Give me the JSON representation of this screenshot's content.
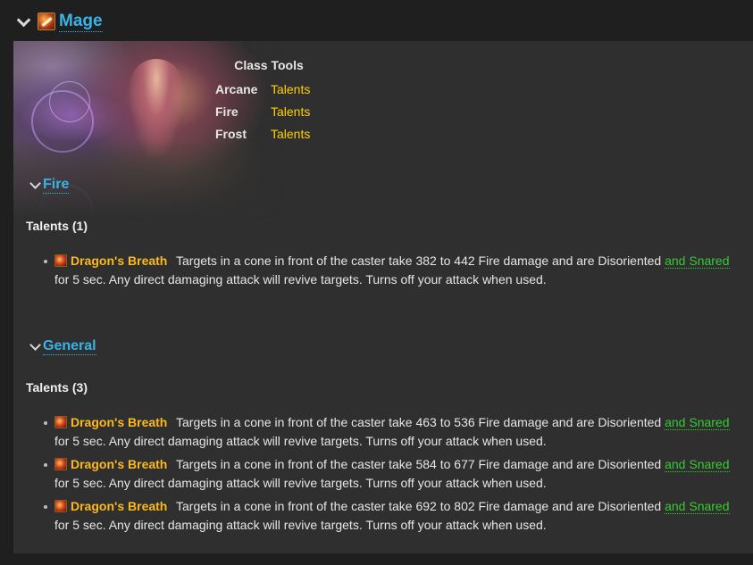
{
  "header": {
    "class_title": "Mage"
  },
  "class_tools": {
    "title": "Class Tools",
    "rows": [
      {
        "spec": "Arcane",
        "link": "Talents"
      },
      {
        "spec": "Fire",
        "link": "Talents"
      },
      {
        "spec": "Frost",
        "link": "Talents"
      }
    ]
  },
  "sections": [
    {
      "title": "Fire",
      "talents_label": "Talents (1)",
      "items": [
        {
          "name": "Dragon's Breath",
          "text_before": "Targets in a cone in front of the caster take 382 to 442 Fire damage and are Disoriented ",
          "green": "and Snared",
          "text_after": " for 5 sec. Any direct damaging attack will revive targets. Turns off your attack when used."
        }
      ]
    },
    {
      "title": "General",
      "talents_label": "Talents (3)",
      "items": [
        {
          "name": "Dragon's Breath",
          "text_before": "Targets in a cone in front of the caster take 463 to 536 Fire damage and are Disoriented ",
          "green": "and Snared",
          "text_after": " for 5 sec. Any direct damaging attack will revive targets. Turns off your attack when used."
        },
        {
          "name": "Dragon's Breath",
          "text_before": "Targets in a cone in front of the caster take 584 to 677 Fire damage and are Disoriented ",
          "green": "and Snared",
          "text_after": " for 5 sec. Any direct damaging attack will revive targets. Turns off your attack when used."
        },
        {
          "name": "Dragon's Breath",
          "text_before": "Targets in a cone in front of the caster take 692 to 802 Fire damage and are Disoriented ",
          "green": "and Snared",
          "text_after": " for 5 sec. Any direct damaging attack will revive targets. Turns off your attack when used."
        }
      ]
    }
  ],
  "colors": {
    "accent_blue": "#39b3e6",
    "talent_name": "#ffb91a",
    "link_yellow": "#ffd100",
    "effect_green": "#33cc33"
  }
}
